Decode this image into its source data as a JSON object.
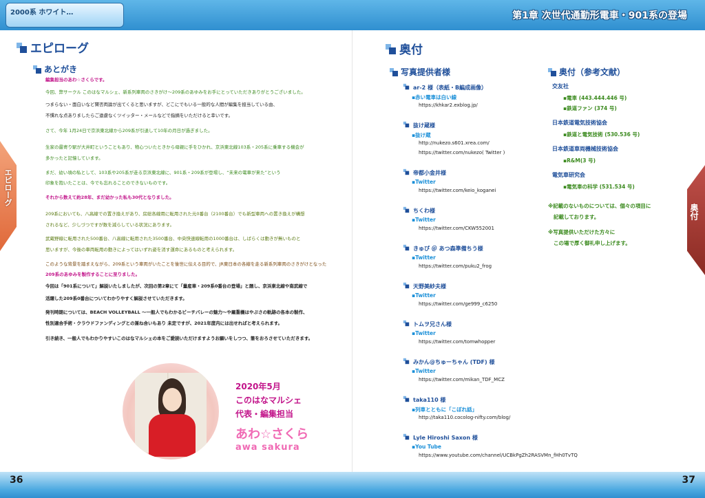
{
  "header": {
    "logo": "2000系 ホワイト…",
    "chapter": "第1章 次世代通勤形電車・901系の登場"
  },
  "left": {
    "tab": "エピローグ",
    "title": "エピローグ",
    "section": "あとがき",
    "lines": [
      {
        "t": "編集担当のあわ☆さくらです。",
        "c": "magenta bold"
      },
      {
        "t": "今回、弊サークル このはなマルシェ、新系列車両のさきがけ～209系のあゆみをお手にとっていただきありがとうございました。",
        "c": "green"
      },
      {
        "t": "つまらない・面白いなど賛否両論が出てくると思いますが、どこにでもいる一般的な人間が編集を担当している由、",
        "c": ""
      },
      {
        "t": "不慣れな点ありましたらご遠慮なくツイッター・メールなどで指摘をいただけると幸いです。",
        "c": ""
      },
      {
        "t": "さて、今年 1月24日で京浜東北線から209系が引退して10年の月日が過ぎました。",
        "c": "green"
      },
      {
        "t": "生家の最寄り駅が大井町ということもあり、物心ついたときから母親に手をひかれ、京浜東北線103系・205系に乗車する機会が",
        "c": "green"
      },
      {
        "t": "多かったと記憶しています。",
        "c": "green"
      },
      {
        "t": "まだ、幼い頃の私として、103系や205系が走る京浜東北線に、901系・209系が登場し、“未来の電車が来た”という",
        "c": "green"
      },
      {
        "t": "印象を抱いたことは、今でも忘れることのできないものです。",
        "c": "green"
      },
      {
        "t": "それから数えて約28年、まだ幼かった私も30代となりました。",
        "c": "magenta bold"
      },
      {
        "t": "209系においても、八高線での置き換えがあり、房総各線用に転用された元0番台（2100番台）でも新型車両への置き換えが構想",
        "c": "olive"
      },
      {
        "t": "されるなど、少しづつですが数を減らしている状況にあります。",
        "c": "olive"
      },
      {
        "t": "武蔵野線に転用された500番台、八高線に転用された3500番台、中央快速線転用の1000番台は、しばらくは動きが無いものと",
        "c": "olive"
      },
      {
        "t": "思いますが、今後の車両転用の動きによってはいずれ姿を消す運命にあるものと考えられます。",
        "c": "olive"
      },
      {
        "t": "このような背景を踏まえながら、209系という車両がいたことを後世に伝える目的で、JR東日本の各線を走る新系列車両のさきがけとなった",
        "c": "brown"
      },
      {
        "t": "209系のあゆみを製作することに至りました。",
        "c": "magenta bold"
      },
      {
        "t": "今回は「901系について」解説いたしましたが、次回の第2章にて「量産車・209系0番台の登場」と題し、京浜東北線や南武線で",
        "c": "bold"
      },
      {
        "t": "活躍した209系0番台についてわかりやすく解説させていただきます。",
        "c": "bold"
      },
      {
        "t": "発刊時期については、BEACH VOLLEYBALL ～一般人でもわかるビーチバレーの魅力～や羅重機はやぶさの軌跡の各本の製作、",
        "c": "bold"
      },
      {
        "t": "性別適合手術・クラウドファンディングとの兼ね合いもあり 未定ですが、2021年度内には出せればと考えられます。",
        "c": "bold"
      },
      {
        "t": "引き続き、一般人でもわかりやすいこのはなマルシェの本をご愛読いただけますようお願いをしつつ、筆をおろさせていただきます。",
        "c": "bold"
      }
    ],
    "signature": {
      "date": "2020年5月",
      "circle": "このはなマルシェ",
      "role": "代表・編集担当",
      "name_jp": "あわ☆さくら",
      "name_en": "awa sakura"
    },
    "page": "36"
  },
  "right": {
    "tab": "奥付",
    "title": "奥付",
    "photo_title": "写真提供者様",
    "ref_title": "奥付（参考文献）",
    "providers": [
      {
        "name": "ar-2 様（表紙・B編成画像）",
        "sub": "▪赤い電車は白い線",
        "urls": [
          "https://khkar2.exblog.jp/"
        ]
      },
      {
        "name": "抜け蔵様",
        "sub": "▪抜け蔵",
        "urls": [
          "http://nukezo.s601.xrea.com/",
          "https://twitter.com/nukezo( Twitter )"
        ]
      },
      {
        "name": "帝都小金井様",
        "sub": "▪Twitter",
        "urls": [
          "https://twitter.com/keio_koganei"
        ]
      },
      {
        "name": "ちくわ様",
        "sub": "▪Twitter",
        "urls": [
          "https://twitter.com/CKW552001"
        ]
      },
      {
        "name": "きゅぴ ＠ あつ森準備ちう様",
        "sub": "▪Twitter",
        "urls": [
          "https://twitter.com/puku2_frog"
        ]
      },
      {
        "name": "天野美紗夫様",
        "sub": "▪Twitter",
        "urls": [
          "https://twitter.com/ge999_c6250"
        ]
      },
      {
        "name": "トムヲ兄さん様",
        "sub": "▪Twitter",
        "urls": [
          "https://twitter.com/tomwhopper"
        ]
      },
      {
        "name": "みかん@ちゅーちゃん (TDF) 様",
        "sub": "▪Twitter",
        "urls": [
          "https://twitter.com/mikan_TDF_MCZ"
        ]
      },
      {
        "name": "taka110 様",
        "sub": "▪列車とともに「こぼれ話」",
        "urls": [
          "http://taka110.cocolog-nifty.com/blog/"
        ]
      },
      {
        "name": "Lyle Hiroshi Saxon 様",
        "sub": "▪You Tube",
        "urls": [
          "https://www.youtube.com/channel/UCBkPgZh2RASVMn_fHh0TvTQ"
        ]
      }
    ],
    "references": [
      {
        "pub": "交友社",
        "items": [
          "▪電車 (443.444.446 号)",
          "▪鉄道ファン (374 号)"
        ]
      },
      {
        "pub": "日本鉄道電気技術協会",
        "items": [
          "▪鉄道と電気技術 (530.536 号)"
        ]
      },
      {
        "pub": "日本鉄道車両機械技術協会",
        "items": [
          "▪R&M(3 号)"
        ]
      },
      {
        "pub": "電気車研究会",
        "items": [
          "▪電気車の科学 (531.534 号)"
        ]
      }
    ],
    "notes": [
      "※記載のないものについては、個々の項目に",
      "記載しております。",
      "※写真提供いただけた方々に",
      "この場で厚く御礼申し上げます。"
    ],
    "page": "37"
  }
}
